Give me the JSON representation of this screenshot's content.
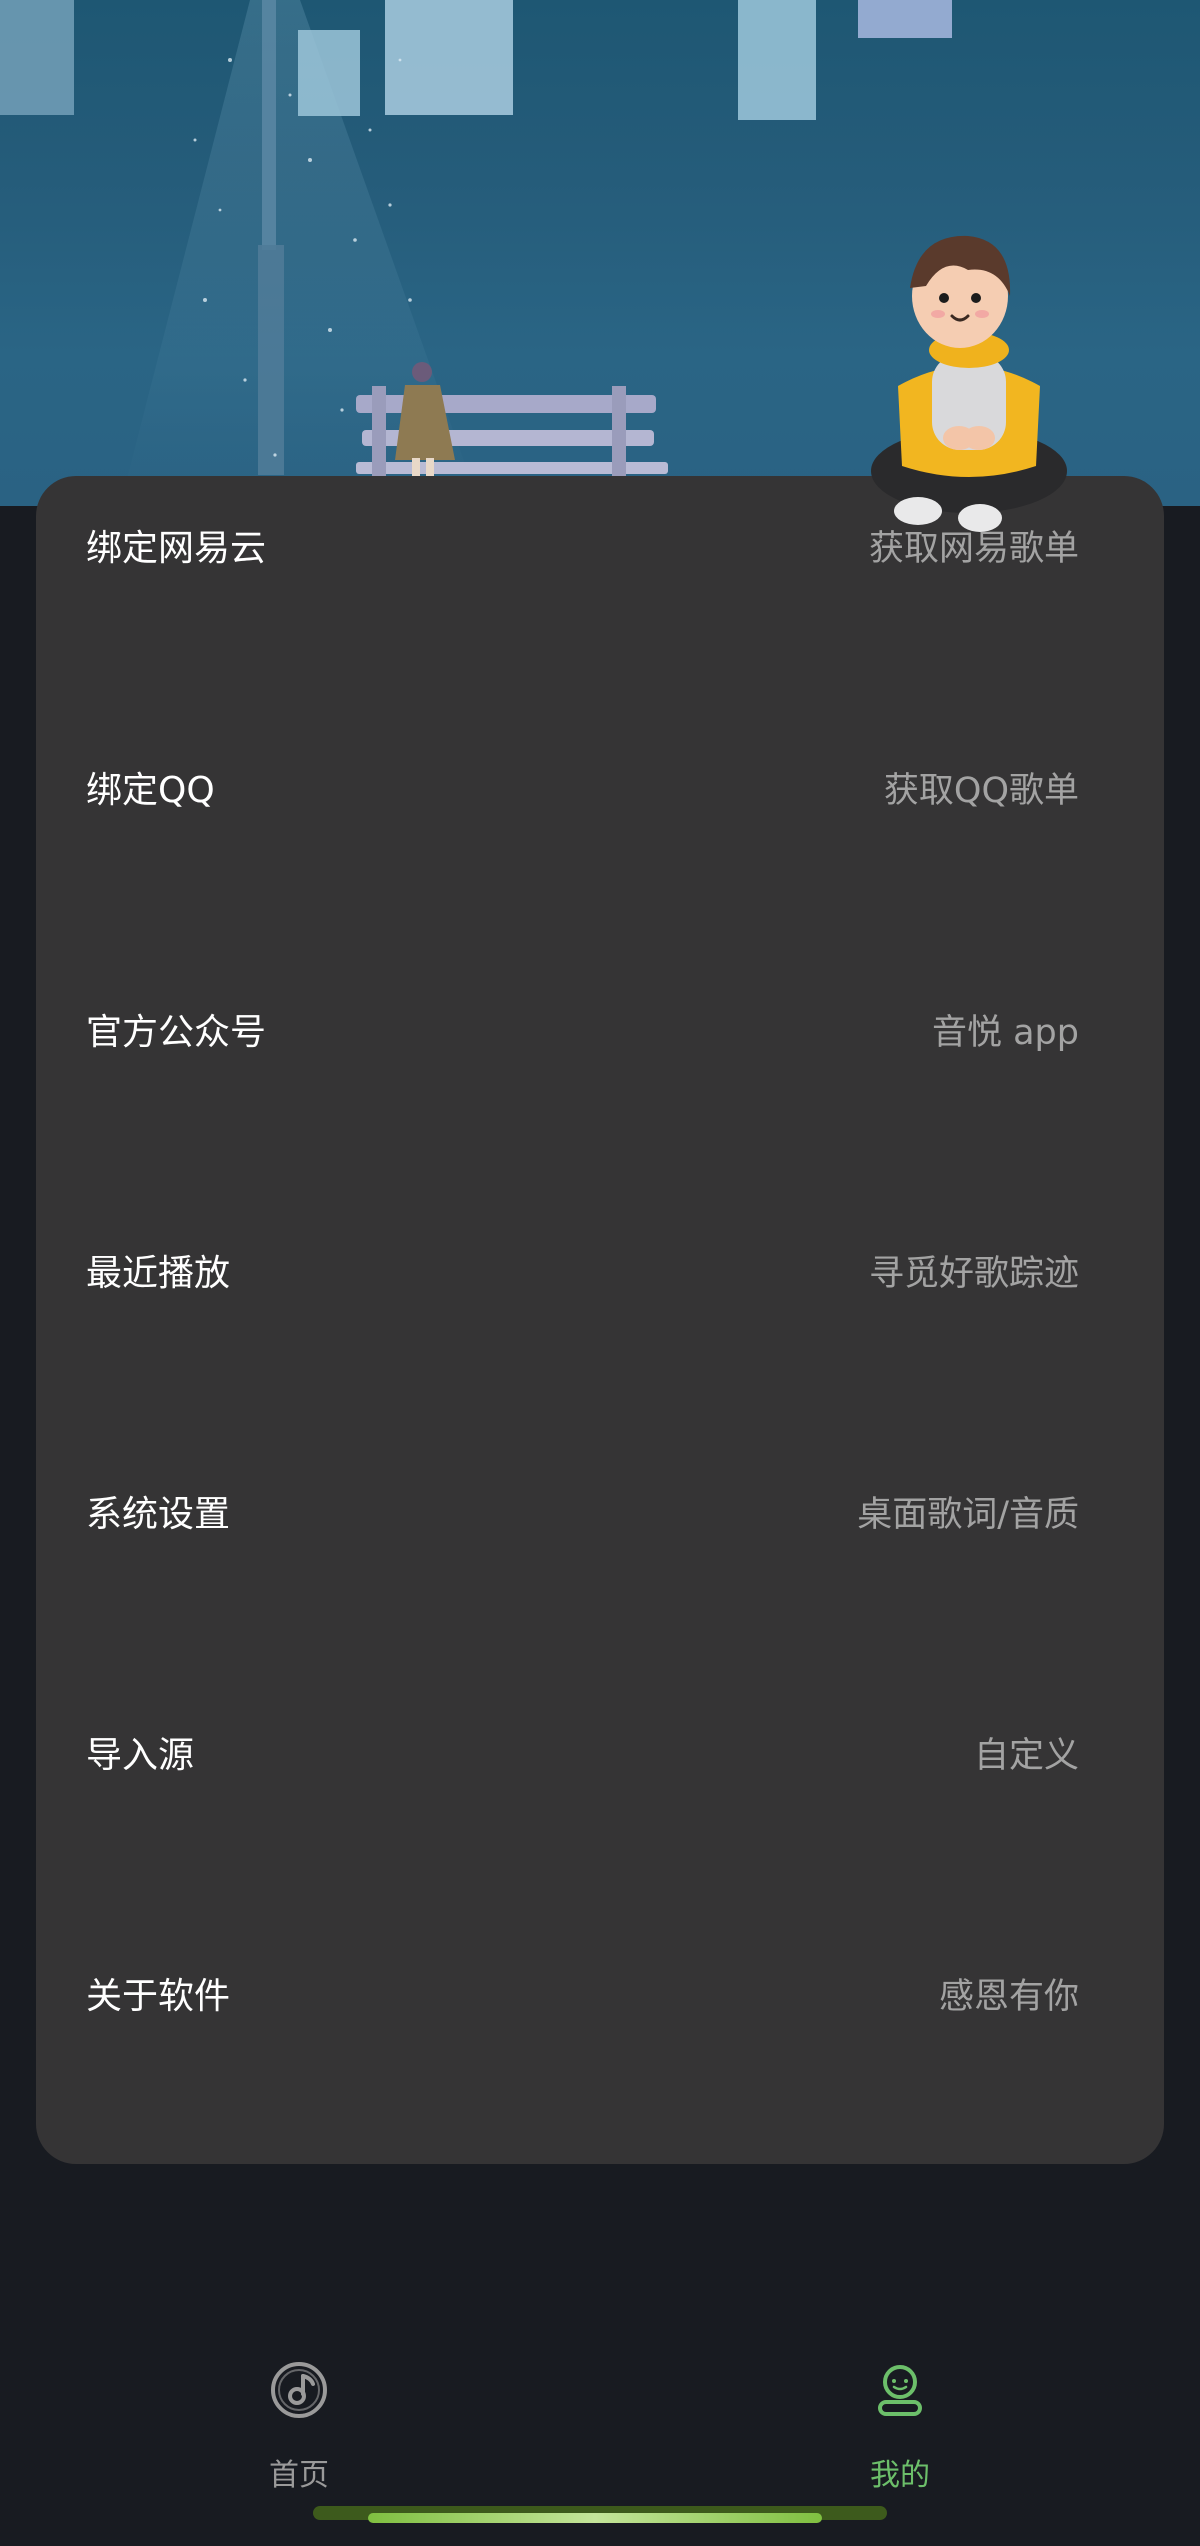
{
  "menu": {
    "items": [
      {
        "label": "绑定网易云",
        "hint": "获取网易歌单",
        "icon": "netease-music"
      },
      {
        "label": "绑定QQ",
        "hint": "获取QQ歌单",
        "icon": "qq-music"
      },
      {
        "label": "官方公众号",
        "hint": "音悦 app",
        "icon": "official-account"
      },
      {
        "label": "最近播放",
        "hint": "寻觅好歌踪迹",
        "icon": "recent-play"
      },
      {
        "label": "系统设置",
        "hint": "桌面歌词/音质",
        "icon": "settings"
      },
      {
        "label": "导入源",
        "hint": "自定义",
        "icon": "import-source"
      },
      {
        "label": "关于软件",
        "hint": "感恩有你",
        "icon": "about"
      }
    ]
  },
  "bottom_nav": {
    "tabs": [
      {
        "label": "首页",
        "icon": "music-disc-icon",
        "active": false
      },
      {
        "label": "我的",
        "icon": "user-icon",
        "active": true
      }
    ],
    "active_color": "#6cbf6a",
    "inactive_color": "#9a9a9a"
  },
  "colors": {
    "card": "#353435",
    "background": "#181b21",
    "hero_sky": "#255c7a"
  }
}
